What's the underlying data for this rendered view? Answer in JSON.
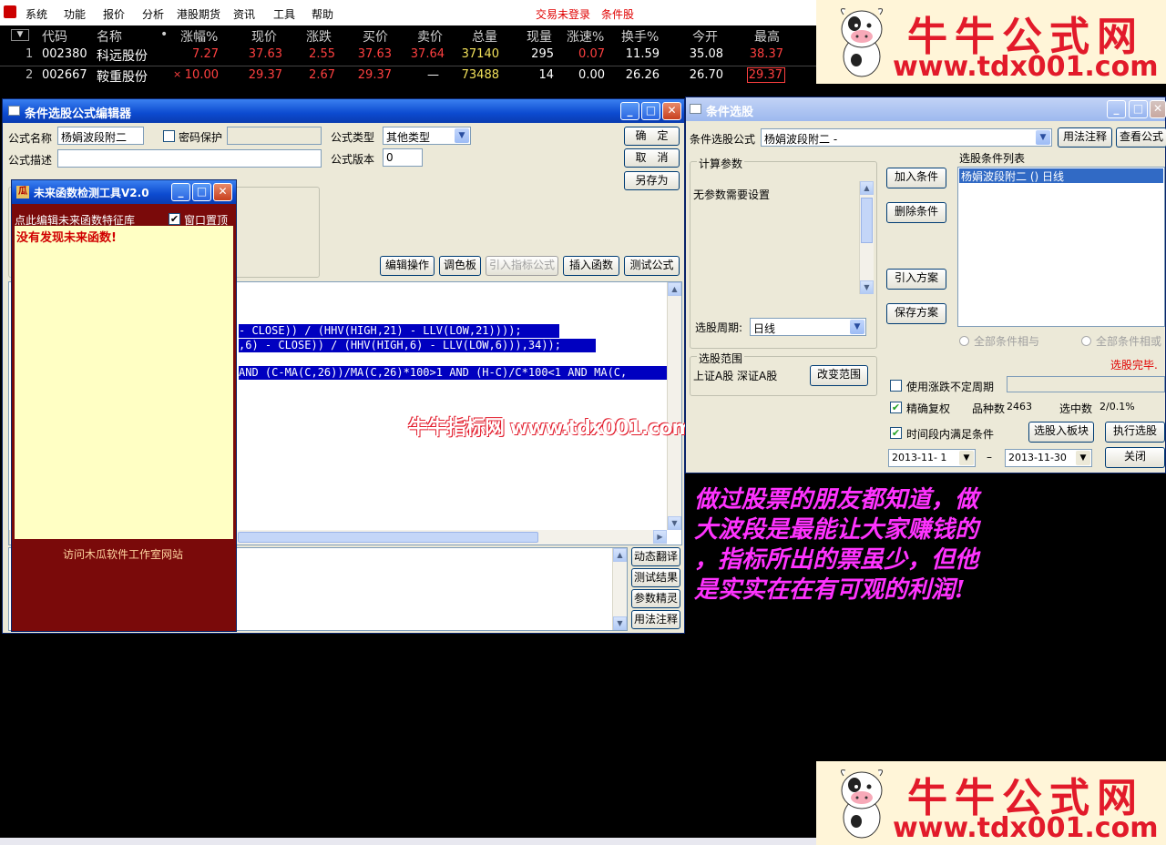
{
  "menubar": {
    "items": [
      "系统",
      "功能",
      "报价",
      "分析",
      "港股期货",
      "资讯",
      "工具",
      "帮助"
    ],
    "status_login": "交易未登录",
    "status_mode": "条件股"
  },
  "stock_table": {
    "headers": [
      "代码",
      "名称",
      "•",
      "涨幅%",
      "现价",
      "涨跌",
      "买价",
      "卖价",
      "总量",
      "现量",
      "涨速%",
      "换手%",
      "今开",
      "最高"
    ],
    "rows": [
      {
        "idx": "1",
        "code": "002380",
        "name": "科远股份",
        "mark": "",
        "chg_pct": "7.27",
        "price": "37.63",
        "chg": "2.55",
        "bid": "37.63",
        "ask": "37.64",
        "vol": "37140",
        "cur_vol": "295",
        "speed": "0.07",
        "turnover": "11.59",
        "open": "35.08",
        "high": "38.37"
      },
      {
        "idx": "2",
        "code": "002667",
        "name": "鞍重股份",
        "mark": "×",
        "chg_pct": "10.00",
        "price": "29.37",
        "chg": "2.67",
        "bid": "29.37",
        "ask": "—",
        "vol": "73488",
        "cur_vol": "14",
        "speed": "0.00",
        "turnover": "26.26",
        "open": "26.70",
        "high": "29.37"
      }
    ]
  },
  "watermark": {
    "brand": "牛牛公式网",
    "url": "www.tdx001.com"
  },
  "editor_window": {
    "title": "条件选股公式编辑器",
    "formula_name_label": "公式名称",
    "formula_name": "杨娟波段附二",
    "password_label": "密码保护",
    "formula_type_label": "公式类型",
    "formula_type": "其他类型",
    "formula_desc_label": "公式描述",
    "formula_version_label": "公式版本",
    "formula_version": "0",
    "ok_button": "确　定",
    "cancel_button": "取　消",
    "saveas_button": "另存为",
    "edit_ops_button": "编辑操作",
    "palette_button": "调色板",
    "import_indicator_button": "引入指标公式",
    "insert_func_button": "插入函数",
    "test_formula_button": "测试公式",
    "code_lines": [
      "- CLOSE)) / (HHV(HIGH,21) - LLV(LOW,21))));",
      ",6) - CLOSE)) / (HHV(HIGH,6) - LLV(LOW,6))),34));",
      "AND (C-MA(C,26))/MA(C,26)*100>1 AND (H-C)/C*100<1 AND MA(C,"
    ],
    "dyn_translate_button": "动态翻译",
    "test_result_button": "测试结果",
    "param_wizard_button": "参数精灵",
    "usage_note_button": "用法注释"
  },
  "overlay_watermark": "牛牛指标网 www.tdx001.com",
  "future_tool": {
    "title": "未来函数检测工具V2.0",
    "edit_lib_label": "点此编辑未来函数特征库",
    "topmost_label": "窗口置顶",
    "result_text": "没有发现未来函数!",
    "visit_label": "访问木瓜软件工作室网站"
  },
  "picker_window": {
    "title": "条件选股",
    "formula_label": "条件选股公式",
    "formula_value": "杨娟波段附二 -",
    "usage_button": "用法注释",
    "view_formula_button": "查看公式",
    "calc_params_label": "计算参数",
    "no_params_text": "无参数需要设置",
    "period_label": "选股周期:",
    "period_value": "日线",
    "add_cond_button": "加入条件",
    "del_cond_button": "删除条件",
    "import_plan_button": "引入方案",
    "save_plan_button": "保存方案",
    "cond_list_label": "选股条件列表",
    "cond_item": "杨娟波段附二 () 日线",
    "all_and_label": "全部条件相与",
    "all_or_label": "全部条件相或",
    "done_text": "选股完毕.",
    "range_label": "选股范围",
    "range_value": "上证A股 深证A股",
    "change_range_button": "改变范围",
    "use_cycle_label": "使用涨跌不定周期",
    "exact_adj_label": "精确复权",
    "count_label": "品种数",
    "count_value": "2463",
    "selected_label": "选中数",
    "selected_value": "2/0.1%",
    "period_cond_label": "时间段内满足条件",
    "to_block_button": "选股入板块",
    "run_button": "执行选股",
    "date_from": "2013-11- 1",
    "date_sep": "–",
    "date_to": "2013-11-30",
    "close_button": "关闭"
  },
  "caption_lines": [
    "做过股票的朋友都知道，做",
    "大波段是最能让大家赚钱的",
    "，指标所出的票虽少，但他",
    "是实实在在有可观的利润!"
  ]
}
